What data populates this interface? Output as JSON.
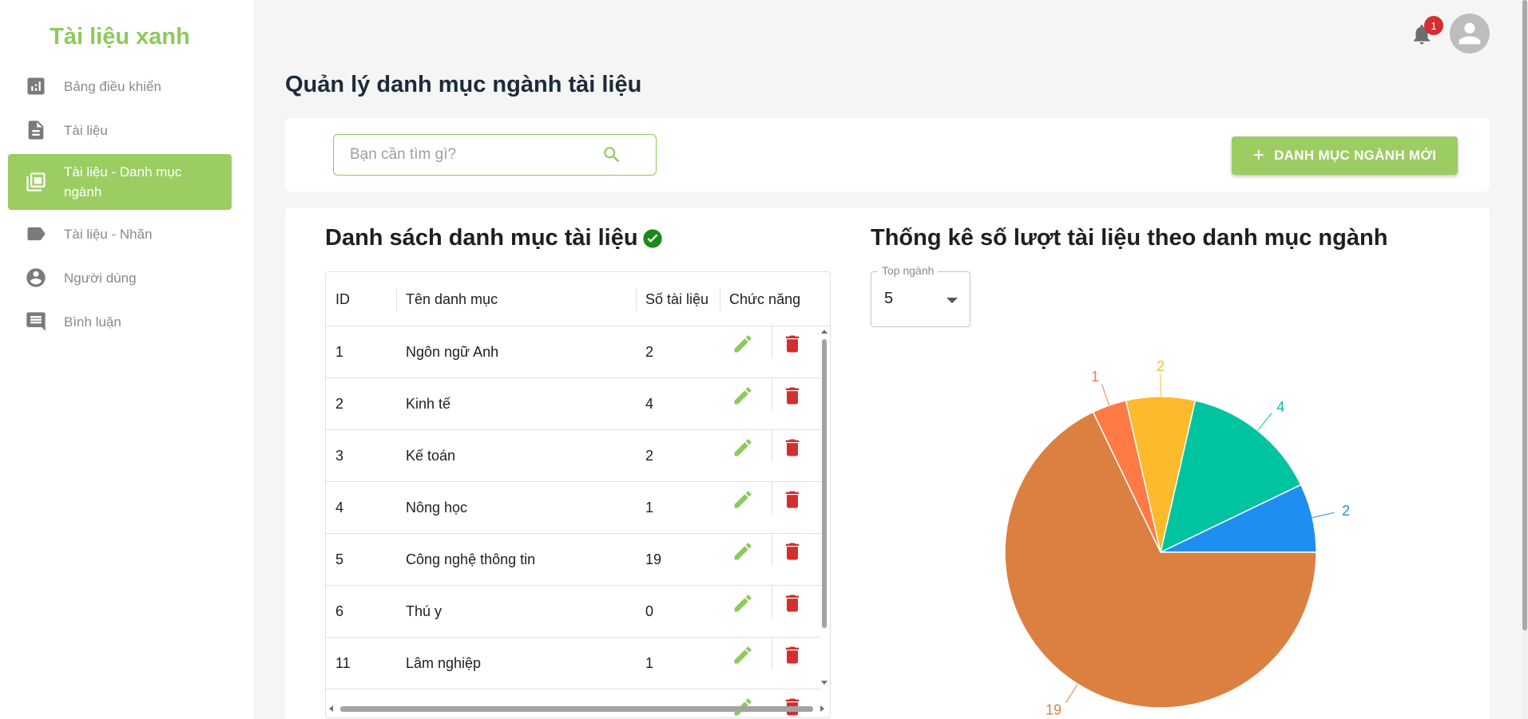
{
  "sidebar": {
    "brand": "Tài liệu xanh",
    "items": [
      {
        "label": "Bảng điều khiển",
        "icon": "dashboard-chart-icon"
      },
      {
        "label": "Tài liệu",
        "icon": "document-icon"
      },
      {
        "label": "Tài liệu - Danh mục ngành",
        "icon": "library-copy-icon",
        "active": true
      },
      {
        "label": "Tài liệu - Nhãn",
        "icon": "label-tag-icon"
      },
      {
        "label": "Người dùng",
        "icon": "account-circle-icon"
      },
      {
        "label": "Bình luận",
        "icon": "comment-icon"
      }
    ]
  },
  "header": {
    "notification_count": "1"
  },
  "page": {
    "title": "Quản lý danh mục ngành tài liệu"
  },
  "toolbar": {
    "search_placeholder": "Bạn cần tìm gì?",
    "new_button": "DANH MỤC NGÀNH MỚI"
  },
  "list": {
    "title": "Danh sách danh mục tài liệu",
    "columns": [
      "ID",
      "Tên danh mục",
      "Số tài liệu",
      "Chức năng"
    ],
    "rows": [
      {
        "id": "1",
        "name": "Ngôn ngữ Anh",
        "count": "2"
      },
      {
        "id": "2",
        "name": "Kinh tế",
        "count": "4"
      },
      {
        "id": "3",
        "name": "Kế toán",
        "count": "2"
      },
      {
        "id": "4",
        "name": "Nông học",
        "count": "1"
      },
      {
        "id": "5",
        "name": "Công nghệ thông tin",
        "count": "19"
      },
      {
        "id": "6",
        "name": "Thú y",
        "count": "0"
      },
      {
        "id": "11",
        "name": "Lâm nghiệp",
        "count": "1"
      }
    ]
  },
  "stats": {
    "title": "Thống kê số lượt tài liệu theo danh mục ngành",
    "select_label": "Top ngành",
    "select_value": "5"
  },
  "chart_data": {
    "type": "pie",
    "title": "",
    "start_angle_deg": 0,
    "direction": "counterclockwise",
    "values": [
      2,
      4,
      2,
      1,
      19
    ],
    "colors": [
      "#1f8ef1",
      "#00c49f",
      "#fdba2c",
      "#ff7a45",
      "#db8040"
    ],
    "data_labels": [
      "2",
      "4",
      "2",
      "1",
      "19"
    ]
  },
  "colors": {
    "brand_green": "#8ec95b",
    "active_green": "#9ccd62",
    "delete_red": "#d32f2f",
    "badge_red": "#d32f2f"
  }
}
